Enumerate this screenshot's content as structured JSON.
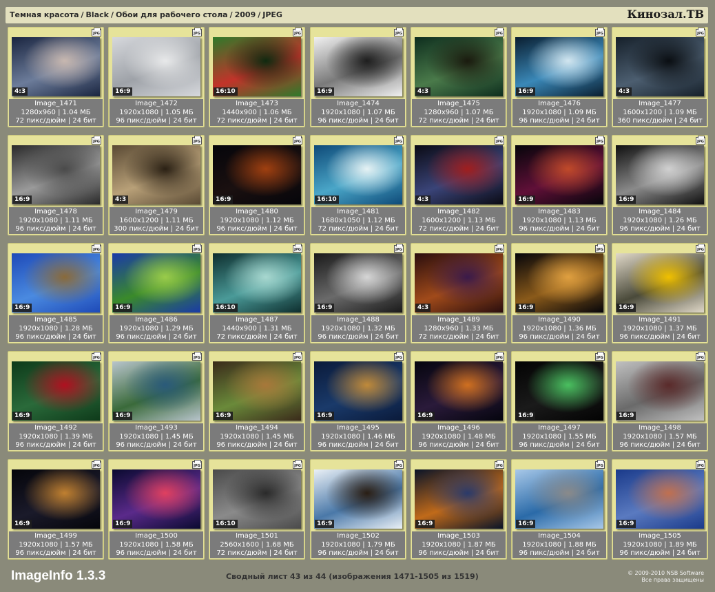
{
  "breadcrumb": [
    "Темная красота",
    "Black",
    "Обои для рабочего стола",
    "2009",
    "JPEG"
  ],
  "breadcrumb_separator": "/",
  "brand": "Кинозал.ТВ",
  "format_badge": "JPG",
  "images": [
    {
      "name": "Image_1471",
      "ratio": "4:3",
      "res": "1280x960",
      "size": "1.04 МБ",
      "dpi": "72 пикс/дюйм",
      "bits": "24 бит",
      "thumb": [
        "#1a2540",
        "#6c7c9a",
        "#c8b8b0"
      ]
    },
    {
      "name": "Image_1472",
      "ratio": "16:9",
      "res": "1920x1080",
      "size": "1.05 МБ",
      "dpi": "96 пикс/дюйм",
      "bits": "24 бит",
      "thumb": [
        "#d6d8dc",
        "#9ea2a8",
        "#e8e9ea"
      ]
    },
    {
      "name": "Image_1473",
      "ratio": "16:10",
      "res": "1440x900",
      "size": "1.06 МБ",
      "dpi": "72 пикс/дюйм",
      "bits": "24 бит",
      "thumb": [
        "#2e7a2a",
        "#c2332a",
        "#0f2a10"
      ]
    },
    {
      "name": "Image_1474",
      "ratio": "16:9",
      "res": "1920x1080",
      "size": "1.07 МБ",
      "dpi": "96 пикс/дюйм",
      "bits": "24 бит",
      "thumb": [
        "#f0f0f0",
        "#7a7a7a",
        "#1e1e1e"
      ]
    },
    {
      "name": "Image_1475",
      "ratio": "4:3",
      "res": "1280x960",
      "size": "1.07 МБ",
      "dpi": "72 пикс/дюйм",
      "bits": "24 бит",
      "thumb": [
        "#0e2e1e",
        "#4a7a4a",
        "#1a1a0e"
      ]
    },
    {
      "name": "Image_1476",
      "ratio": "16:9",
      "res": "1920x1080",
      "size": "1.09 МБ",
      "dpi": "96 пикс/дюйм",
      "bits": "24 бит",
      "thumb": [
        "#0a1e30",
        "#3a88b8",
        "#d2e6f0"
      ]
    },
    {
      "name": "Image_1477",
      "ratio": "4:3",
      "res": "1600x1200",
      "size": "1.09 МБ",
      "dpi": "360 пикс/дюйм",
      "bits": "24 бит",
      "thumb": [
        "#16202a",
        "#4c5e70",
        "#0a0e12"
      ]
    },
    {
      "name": "Image_1478",
      "ratio": "16:9",
      "res": "1920x1080",
      "size": "1.11 МБ",
      "dpi": "96 пикс/дюйм",
      "bits": "24 бит",
      "thumb": [
        "#2a2a2a",
        "#9a9a9a",
        "#4a4a4a"
      ]
    },
    {
      "name": "Image_1479",
      "ratio": "4:3",
      "res": "1600x1200",
      "size": "1.11 МБ",
      "dpi": "300 пикс/дюйм",
      "bits": "24 бит",
      "thumb": [
        "#5a4a34",
        "#b8a078",
        "#2a2014"
      ]
    },
    {
      "name": "Image_1480",
      "ratio": "16:9",
      "res": "1920x1080",
      "size": "1.12 МБ",
      "dpi": "96 пикс/дюйм",
      "bits": "24 бит",
      "thumb": [
        "#05050a",
        "#1a1010",
        "#a04010"
      ]
    },
    {
      "name": "Image_1481",
      "ratio": "16:10",
      "res": "1680x1050",
      "size": "1.12 МБ",
      "dpi": "72 пикс/дюйм",
      "bits": "24 бит",
      "thumb": [
        "#0e4a78",
        "#4aa6c8",
        "#e6f2f4"
      ]
    },
    {
      "name": "Image_1482",
      "ratio": "4:3",
      "res": "1600x1200",
      "size": "1.13 МБ",
      "dpi": "72 пикс/дюйм",
      "bits": "24 бит",
      "thumb": [
        "#0a0a14",
        "#3a4478",
        "#a01e1e"
      ]
    },
    {
      "name": "Image_1483",
      "ratio": "16:9",
      "res": "1920x1080",
      "size": "1.13 МБ",
      "dpi": "96 пикс/дюйм",
      "bits": "24 бит",
      "thumb": [
        "#05050a",
        "#601038",
        "#c04a2a"
      ]
    },
    {
      "name": "Image_1484",
      "ratio": "16:9",
      "res": "1920x1080",
      "size": "1.26 МБ",
      "dpi": "96 пикс/дюйм",
      "bits": "24 бит",
      "thumb": [
        "#101010",
        "#8a8a8a",
        "#d0d0d0"
      ]
    },
    {
      "name": "Image_1485",
      "ratio": "16:9",
      "res": "1920x1080",
      "size": "1.28 МБ",
      "dpi": "96 пикс/дюйм",
      "bits": "24 бит",
      "thumb": [
        "#1e4ab8",
        "#4a8ae0",
        "#8a6a3a"
      ]
    },
    {
      "name": "Image_1486",
      "ratio": "16:9",
      "res": "1920x1080",
      "size": "1.29 МБ",
      "dpi": "96 пикс/дюйм",
      "bits": "24 бит",
      "thumb": [
        "#1a3aa8",
        "#3a8a2a",
        "#9acc4a"
      ]
    },
    {
      "name": "Image_1487",
      "ratio": "16:10",
      "res": "1440x900",
      "size": "1.31 МБ",
      "dpi": "72 пикс/дюйм",
      "bits": "24 бит",
      "thumb": [
        "#0e2e2e",
        "#4a9a98",
        "#a8d8d0"
      ]
    },
    {
      "name": "Image_1488",
      "ratio": "16:9",
      "res": "1920x1080",
      "size": "1.32 МБ",
      "dpi": "96 пикс/дюйм",
      "bits": "24 бит",
      "thumb": [
        "#1a1a1a",
        "#6a6a6a",
        "#d6d6d6"
      ]
    },
    {
      "name": "Image_1489",
      "ratio": "4:3",
      "res": "1280x960",
      "size": "1.33 МБ",
      "dpi": "72 пикс/дюйм",
      "bits": "24 бит",
      "thumb": [
        "#2a0e0e",
        "#a04a1a",
        "#3a1a4a"
      ]
    },
    {
      "name": "Image_1490",
      "ratio": "16:9",
      "res": "1920x1080",
      "size": "1.36 МБ",
      "dpi": "96 пикс/дюйм",
      "bits": "24 бит",
      "thumb": [
        "#05050a",
        "#8a5a1a",
        "#e0a040"
      ]
    },
    {
      "name": "Image_1491",
      "ratio": "16:9",
      "res": "1920x1080",
      "size": "1.37 МБ",
      "dpi": "96 пикс/дюйм",
      "bits": "24 бит",
      "thumb": [
        "#e0d8c8",
        "#4a4a3a",
        "#f0c000"
      ]
    },
    {
      "name": "Image_1492",
      "ratio": "16:9",
      "res": "1920x1080",
      "size": "1.39 МБ",
      "dpi": "96 пикс/дюйм",
      "bits": "24 бит",
      "thumb": [
        "#0e3a1a",
        "#2a6a3a",
        "#b01020"
      ]
    },
    {
      "name": "Image_1493",
      "ratio": "16:9",
      "res": "1920x1080",
      "size": "1.45 МБ",
      "dpi": "96 пикс/дюйм",
      "bits": "24 бит",
      "thumb": [
        "#b8c4cc",
        "#3a6a3a",
        "#2a5a7a"
      ]
    },
    {
      "name": "Image_1494",
      "ratio": "16:9",
      "res": "1920x1080",
      "size": "1.45 МБ",
      "dpi": "96 пикс/дюйм",
      "bits": "24 бит",
      "thumb": [
        "#3a2a1a",
        "#6a8a3a",
        "#a8783a"
      ]
    },
    {
      "name": "Image_1495",
      "ratio": "16:9",
      "res": "1920x1080",
      "size": "1.46 МБ",
      "dpi": "96 пикс/дюйм",
      "bits": "24 бит",
      "thumb": [
        "#0a1a3a",
        "#1a3a6a",
        "#c08a3a"
      ]
    },
    {
      "name": "Image_1496",
      "ratio": "16:9",
      "res": "1920x1080",
      "size": "1.48 МБ",
      "dpi": "96 пикс/дюйм",
      "bits": "24 бит",
      "thumb": [
        "#05050e",
        "#2a1a3a",
        "#d07020"
      ]
    },
    {
      "name": "Image_1497",
      "ratio": "16:9",
      "res": "1920x1080",
      "size": "1.55 МБ",
      "dpi": "96 пикс/дюйм",
      "bits": "24 бит",
      "thumb": [
        "#030303",
        "#1a1a1a",
        "#4ac060"
      ]
    },
    {
      "name": "Image_1498",
      "ratio": "16:9",
      "res": "1920x1080",
      "size": "1.57 МБ",
      "dpi": "96 пикс/дюйм",
      "bits": "24 бит",
      "thumb": [
        "#c0c0c0",
        "#6a6a6a",
        "#5a2a2a"
      ]
    },
    {
      "name": "Image_1499",
      "ratio": "16:9",
      "res": "1920x1080",
      "size": "1.57 МБ",
      "dpi": "96 пикс/дюйм",
      "bits": "24 бит",
      "thumb": [
        "#05050a",
        "#1a1a2a",
        "#c08030"
      ]
    },
    {
      "name": "Image_1500",
      "ratio": "16:9",
      "res": "1920x1080",
      "size": "1.58 МБ",
      "dpi": "96 пикс/дюйм",
      "bits": "24 бит",
      "thumb": [
        "#0a0a30",
        "#5a2a8a",
        "#e04060"
      ]
    },
    {
      "name": "Image_1501",
      "ratio": "16:10",
      "res": "2560x1600",
      "size": "1.68 МБ",
      "dpi": "72 пикс/дюйм",
      "bits": "24 бит",
      "thumb": [
        "#4a4a4a",
        "#8a8a8a",
        "#2a2a2a"
      ]
    },
    {
      "name": "Image_1502",
      "ratio": "16:9",
      "res": "1920x1080",
      "size": "1.79 МБ",
      "dpi": "96 пикс/дюйм",
      "bits": "24 бит",
      "thumb": [
        "#eaf0f6",
        "#4a78a8",
        "#2a1e14"
      ]
    },
    {
      "name": "Image_1503",
      "ratio": "16:9",
      "res": "1920x1080",
      "size": "1.87 МБ",
      "dpi": "96 пикс/дюйм",
      "bits": "24 бит",
      "thumb": [
        "#0a1428",
        "#c06a1a",
        "#2a3a6a"
      ]
    },
    {
      "name": "Image_1504",
      "ratio": "16:9",
      "res": "1920x1080",
      "size": "1.88 МБ",
      "dpi": "96 пикс/дюйм",
      "bits": "24 бит",
      "thumb": [
        "#a8c8e8",
        "#2a6aa8",
        "#8a8a8a"
      ]
    },
    {
      "name": "Image_1505",
      "ratio": "16:9",
      "res": "1920x1080",
      "size": "1.89 МБ",
      "dpi": "96 пикс/дюйм",
      "bits": "24 бит",
      "thumb": [
        "#1a3a8a",
        "#5a7ac0",
        "#c07050"
      ]
    }
  ],
  "footer": {
    "app_name": "ImageInfo 1.3.3",
    "summary": "Сводный лист 43 из 44 (изображения 1471-1505 из 1519)",
    "copyright_line1": "© 2009-2010 NSB Software",
    "copyright_line2": "Все права защищены"
  }
}
